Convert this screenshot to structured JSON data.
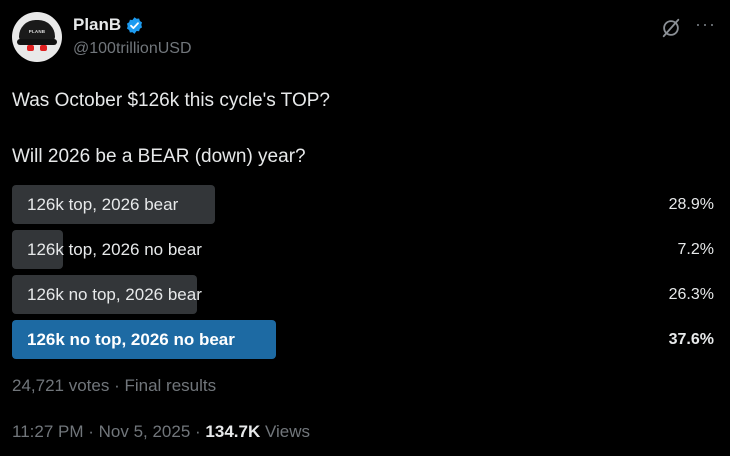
{
  "author": {
    "name": "PlanB",
    "handle": "@100trillionUSD",
    "avatar_cap_text": "PLANB",
    "verified_color": "#1d9bf0"
  },
  "header_icons": {
    "grok": "grok-icon",
    "more": "more-icon",
    "more_glyph": "···"
  },
  "tweet": {
    "line1": "Was October $126k this cycle's TOP?",
    "line2": "Will 2026 be a BEAR (down) year?"
  },
  "poll": {
    "options": [
      {
        "label": "126k top, 2026 bear",
        "percent": "28.9%",
        "value": 28.9,
        "winner": false
      },
      {
        "label": "126k top, 2026 no bear",
        "percent": "7.2%",
        "value": 7.2,
        "winner": false
      },
      {
        "label": "126k no top, 2026 bear",
        "percent": "26.3%",
        "value": 26.3,
        "winner": false
      },
      {
        "label": "126k no top, 2026 no bear",
        "percent": "37.6%",
        "value": 37.6,
        "winner": true
      }
    ],
    "votes_line": "24,721 votes · Final results"
  },
  "meta": {
    "time_date": "11:27 PM · Nov 5, 2025 · ",
    "views_count": "134.7K",
    "views_label": " Views"
  },
  "colors": {
    "bar": "#333639",
    "winner_bar": "#1d6aa3",
    "muted": "#71767b",
    "text": "#e7e9ea"
  }
}
